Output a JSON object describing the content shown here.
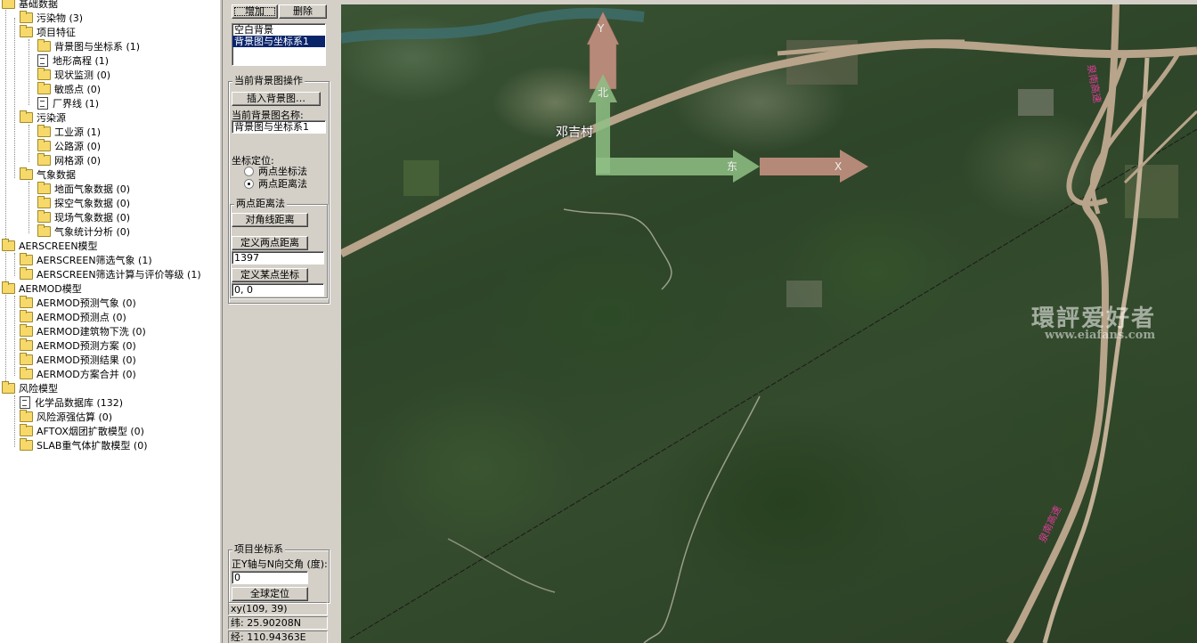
{
  "tree": {
    "root": "基础数据",
    "items": [
      {
        "label": "污染物 (3)"
      },
      {
        "label": "项目特征"
      },
      {
        "label": "背景图与坐标系 (1)"
      },
      {
        "label": "地形高程 (1)"
      },
      {
        "label": "现状监测 (0)"
      },
      {
        "label": "敏感点 (0)"
      },
      {
        "label": "厂界线 (1)"
      },
      {
        "label": "污染源"
      },
      {
        "label": "工业源 (1)"
      },
      {
        "label": "公路源 (0)"
      },
      {
        "label": "网格源 (0)"
      },
      {
        "label": "气象数据"
      },
      {
        "label": "地面气象数据 (0)"
      },
      {
        "label": "探空气象数据 (0)"
      },
      {
        "label": "现场气象数据 (0)"
      },
      {
        "label": "气象统计分析 (0)"
      },
      {
        "label": "AERSCREEN模型"
      },
      {
        "label": "AERSCREEN筛选气象 (1)"
      },
      {
        "label": "AERSCREEN筛选计算与评价等级 (1)"
      },
      {
        "label": "AERMOD模型"
      },
      {
        "label": "AERMOD预测气象 (0)"
      },
      {
        "label": "AERMOD预测点 (0)"
      },
      {
        "label": "AERMOD建筑物下洗 (0)"
      },
      {
        "label": "AERMOD预测方案 (0)"
      },
      {
        "label": "AERMOD预测结果 (0)"
      },
      {
        "label": "AERMOD方案合并 (0)"
      },
      {
        "label": "风险模型"
      },
      {
        "label": "化学品数据库 (132)"
      },
      {
        "label": "风险源强估算 (0)"
      },
      {
        "label": "AFTOX烟团扩散模型 (0)"
      },
      {
        "label": "SLAB重气体扩散模型 (0)"
      }
    ]
  },
  "panel": {
    "add_button": "增加",
    "delete_button": "删除",
    "background_list": [
      "空白背景",
      "背景图与坐标系1"
    ],
    "ops_group_title": "当前背景图操作",
    "insert_button": "插入背景图…",
    "name_label": "当前背景图名称:",
    "name_value": "背景图与坐标系1",
    "coord_label": "坐标定位:",
    "radio_two_point_coords": "两点坐标法",
    "radio_two_point_distance": "两点距离法",
    "distance_group_title": "两点距离法",
    "diagonal_button": "对角线距离",
    "define_distance_button": "定义两点距离",
    "distance_value": "1397",
    "define_point_button": "定义某点坐标",
    "point_value": "0, 0",
    "project_group_title": "项目坐标系",
    "angle_label": "正Y轴与N向交角 (度):",
    "angle_value": "0",
    "global_button": "全球定位",
    "status_xy": "xy(109, 39)",
    "status_lat": "纬: 25.90208N",
    "status_lon": "经: 110.94363E"
  },
  "map": {
    "village_label": "邓吉村",
    "axis_y_label": "Y",
    "axis_x_label": "X",
    "north_label": "北",
    "east_label": "东",
    "watermark_cn": "環評爱好者",
    "watermark_url": "www.eiafans.com",
    "road_label_1": "泉南高速",
    "road_label_2": "泉南高速",
    "colors": {
      "road": "#b8a48a",
      "axis_red": "#c49080",
      "axis_green": "#8fbf85",
      "road_label": "#e23b9b"
    }
  }
}
